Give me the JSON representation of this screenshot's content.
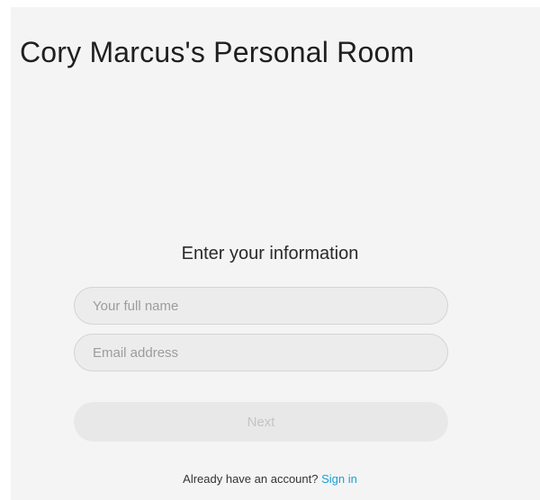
{
  "room": {
    "title": "Cory Marcus's Personal Room"
  },
  "form": {
    "heading": "Enter your information",
    "name_placeholder": "Your full name",
    "email_placeholder": "Email address",
    "next_label": "Next"
  },
  "signin": {
    "prompt": "Already have an account?",
    "link_label": "Sign in"
  },
  "colors": {
    "background": "#f4f4f4",
    "link": "#1a9fd6",
    "button_disabled_bg": "#e8e8e8",
    "button_disabled_text": "#c4c4c4"
  }
}
